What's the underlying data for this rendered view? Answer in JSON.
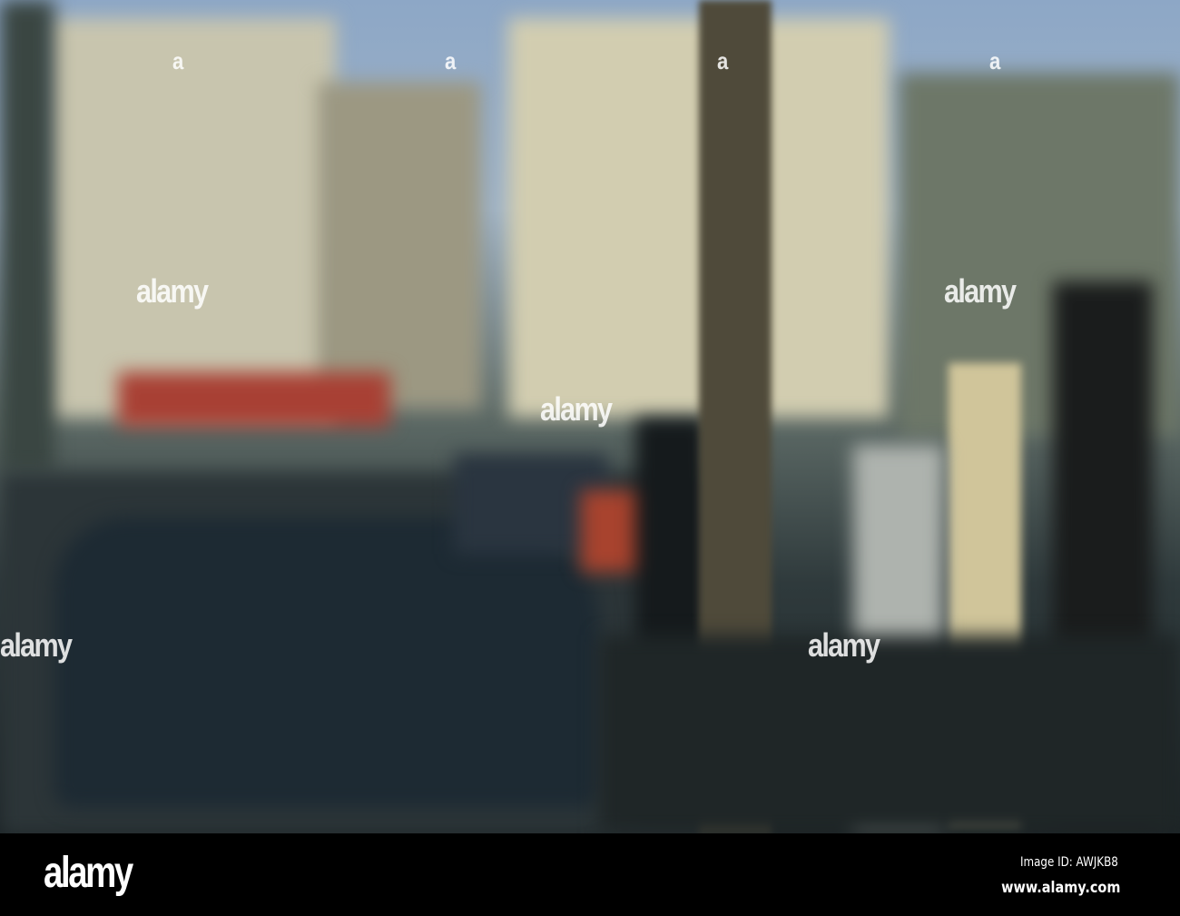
{
  "watermark": {
    "text": "alamy",
    "small_text": "a"
  },
  "footer": {
    "logo": "alamy",
    "image_id": "Image ID: AWJKB8",
    "url": "www.alamy.com"
  },
  "colors": {
    "sky": "#9fb3c7",
    "buildings": "#c9c4a8",
    "road": "#2f3a3c"
  }
}
